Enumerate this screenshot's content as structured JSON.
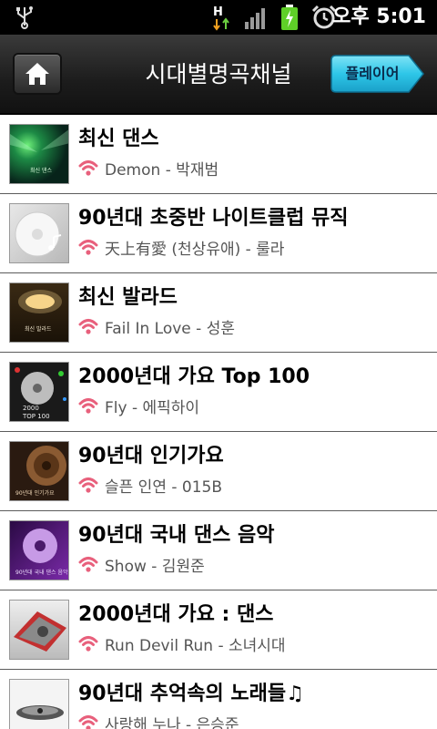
{
  "status_bar": {
    "time": "오후 5:01",
    "icons": [
      "usb-icon",
      "h-data-icon",
      "signal-icon",
      "battery-charging-icon",
      "alarm-icon"
    ]
  },
  "header": {
    "title": "시대별명곡채널",
    "home_icon": "home-icon",
    "player_button_label": "플레이어",
    "accent_color": "#2ec6e8"
  },
  "channels": [
    {
      "title": "최신 댄스",
      "now_playing": "Demon - 박재범"
    },
    {
      "title": "90년대 초중반 나이트클럽 뮤직",
      "now_playing": "天上有愛 (천상유애) - 룰라"
    },
    {
      "title": "최신 발라드",
      "now_playing": "Fail In Love - 성훈"
    },
    {
      "title": "2000년대 가요 Top 100",
      "now_playing": "Fly - 에픽하이"
    },
    {
      "title": "90년대 인기가요",
      "now_playing": "슬픈 인연 - 015B"
    },
    {
      "title": "90년대 국내 댄스 음악",
      "now_playing": "Show - 김원준"
    },
    {
      "title": "2000년대 가요 : 댄스",
      "now_playing": "Run Devil Run - 소녀시대"
    },
    {
      "title": "90년대 추억속의 노래들♫",
      "now_playing": "사랑해 누나 - 은승준"
    }
  ],
  "stream_icon": "wifi-stream-icon",
  "stream_icon_color": "#e8607c"
}
